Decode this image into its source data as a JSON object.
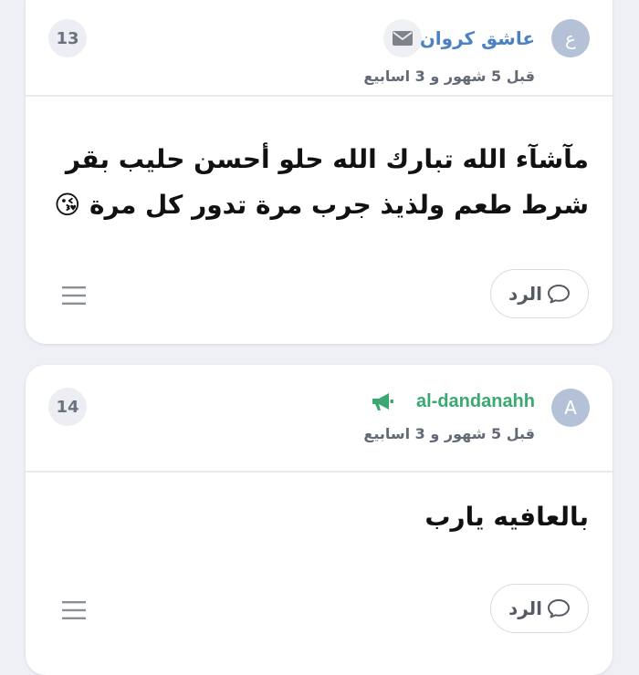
{
  "posts": [
    {
      "number": "13",
      "avatar_letter": "ع",
      "username": "عاشق كروان",
      "timestamp": "قبل 5 شهور و 3 اسابيع",
      "text_line1": "مآشآء الله تبارك الله حلو أحسن حليب بقر",
      "text_line2": "شرط طعم ولذيذ جرب مرة تدور كل مرة 😘",
      "reply_label": "الرد",
      "icons": {
        "message": "envelope-icon",
        "reply": "speech-bubble-icon",
        "menu": "hamburger-menu-icon"
      }
    },
    {
      "number": "14",
      "avatar_letter": "A",
      "username": "al-dandanahh",
      "timestamp": "قبل 5 شهور و 3 اسابيع",
      "text_line1": "بالعافيه يارب",
      "reply_label": "الرد",
      "icons": {
        "badge": "megaphone-icon",
        "reply": "speech-bubble-icon",
        "menu": "hamburger-menu-icon"
      }
    }
  ],
  "colors": {
    "accent_blue": "#4c82c3",
    "accent_green": "#3aa870",
    "avatar_bg": "#b4c1d7",
    "page_bg": "#eef0f5"
  }
}
